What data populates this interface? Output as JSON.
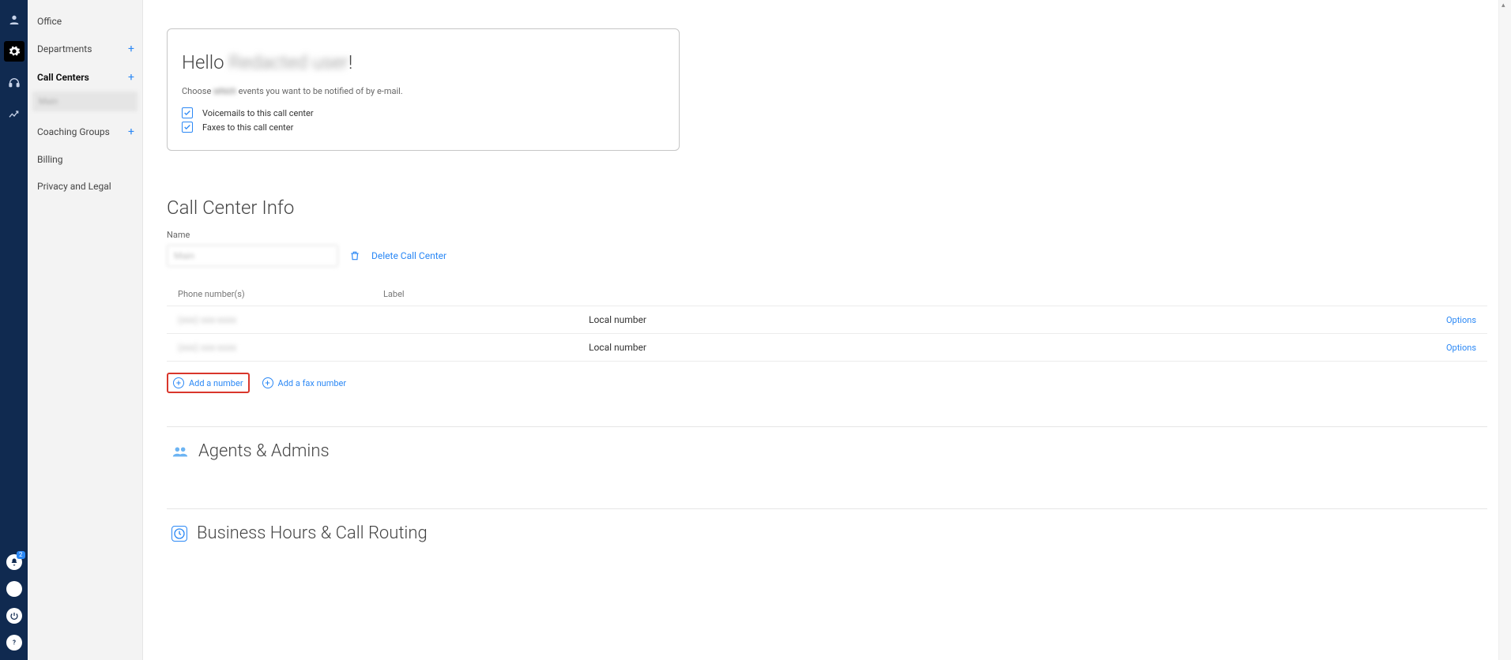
{
  "rail": {
    "notification_badge": "2"
  },
  "sidebar": {
    "items": [
      {
        "label": "Office"
      },
      {
        "label": "Departments"
      },
      {
        "label": "Call Centers"
      },
      {
        "label": "Coaching Groups"
      },
      {
        "label": "Billing"
      },
      {
        "label": "Privacy and Legal"
      }
    ],
    "active_sub": "Main"
  },
  "welcome": {
    "hello_prefix": "Hello ",
    "hello_name_blur": "Redacted user",
    "hello_suffix": "!",
    "choose_prefix": "Choose",
    "choose_blur": "which",
    "choose_suffix": "events you want to be notified of by e-mail.",
    "checks": [
      "Voicemails to this call center",
      "Faxes to this call center"
    ]
  },
  "call_center_info": {
    "heading": "Call Center Info",
    "name_label": "Name",
    "name_value": "Main",
    "delete_label": "Delete Call Center",
    "table": {
      "headers": {
        "phone": "Phone number(s)",
        "label": "Label"
      },
      "rows": [
        {
          "number": "(xxx) xxx-xxxx",
          "type": "Local number",
          "options": "Options"
        },
        {
          "number": "(xxx) xxx-xxxx",
          "type": "Local number",
          "options": "Options"
        }
      ]
    },
    "add_number": "Add a number",
    "add_fax": "Add a fax number"
  },
  "sections": {
    "agents": "Agents & Admins",
    "routing": "Business Hours & Call Routing"
  }
}
